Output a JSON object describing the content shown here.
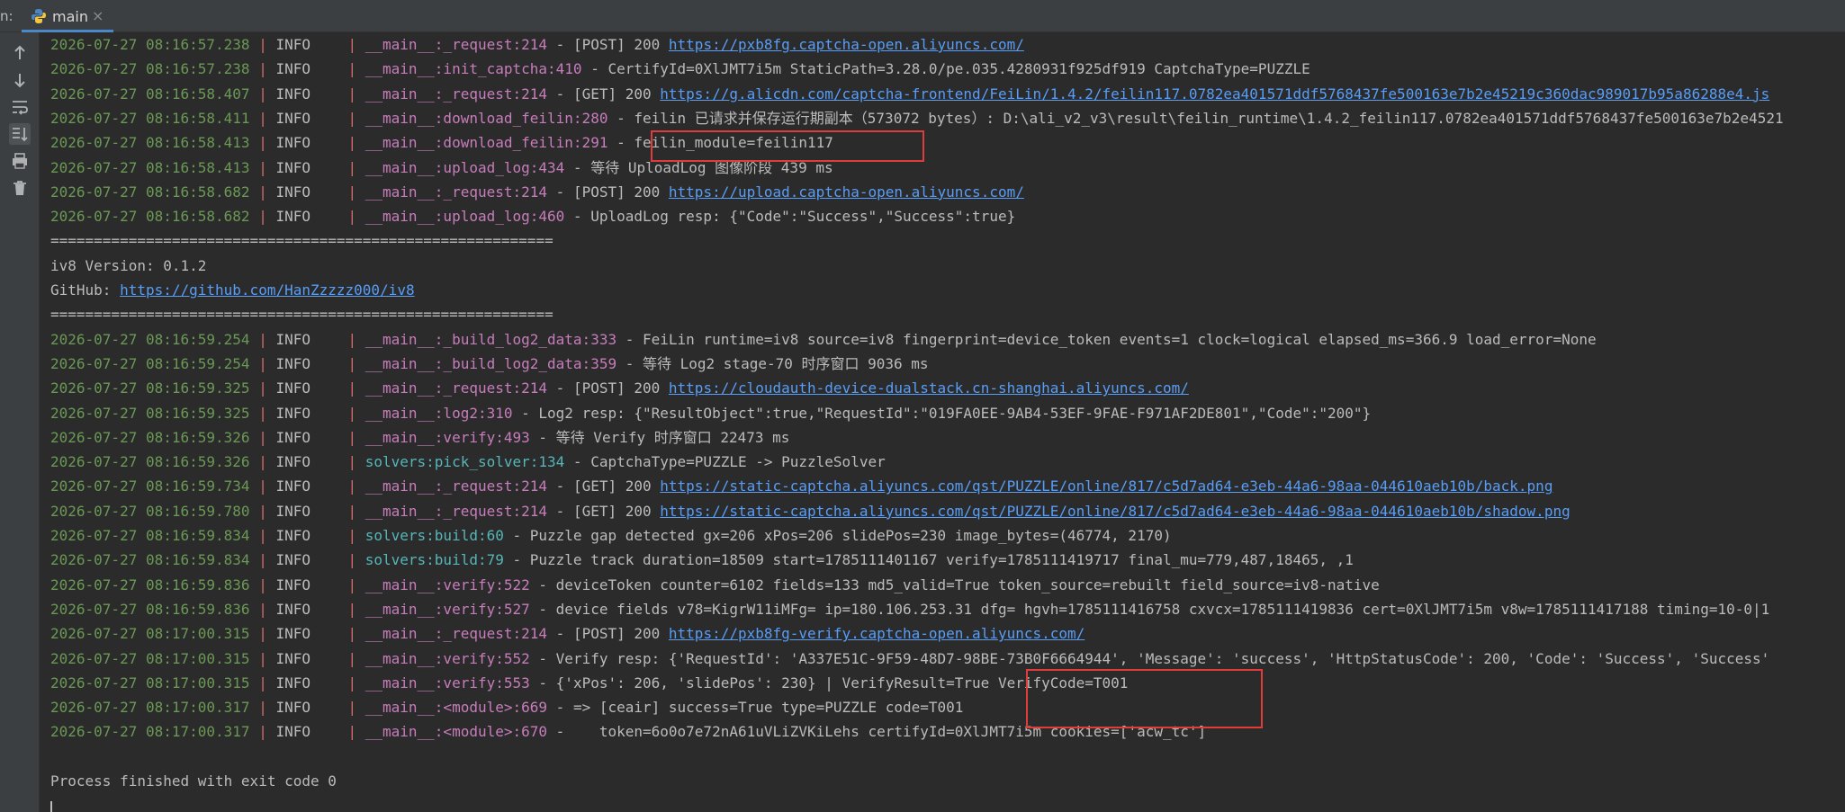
{
  "tabbar": {
    "run_label": "n:",
    "tab_label": "main",
    "tab_close": "×"
  },
  "toolbar": {
    "buttons": [
      {
        "name": "scroll-up-icon"
      },
      {
        "name": "scroll-down-icon"
      },
      {
        "name": "soft-wrap-icon"
      },
      {
        "name": "scroll-to-end-icon"
      },
      {
        "name": "print-icon"
      },
      {
        "name": "clear-icon"
      }
    ]
  },
  "colors": {
    "timestamp": "#6a9955",
    "separator": "#d16b6b",
    "module_function": "#c77dbb",
    "solver_module": "#56b6b9",
    "link": "#589df6",
    "highlight_box": "#e03c3c"
  },
  "console": {
    "lines": [
      {
        "ts": "2026-07-27 08:16:57.238",
        "lvl": "INFO",
        "mod": "__main__:_request:214",
        "mod_class": "modfn",
        "pre": "[POST] 200 ",
        "link": "https://pxb8fg.captcha-open.aliyuncs.com/",
        "post": ""
      },
      {
        "ts": "2026-07-27 08:16:57.238",
        "lvl": "INFO",
        "mod": "__main__:init_captcha:410",
        "mod_class": "modfn",
        "pre": "CertifyId=0XlJMT7i5m StaticPath=3.28.0/pe.035.4280931f925df919 CaptchaType=PUZZLE",
        "link": "",
        "post": ""
      },
      {
        "ts": "2026-07-27 08:16:58.407",
        "lvl": "INFO",
        "mod": "__main__:_request:214",
        "mod_class": "modfn",
        "pre": "[GET] 200 ",
        "link": "https://g.alicdn.com/captcha-frontend/FeiLin/1.4.2/feilin117.0782ea401571ddf5768437fe500163e7b2e45219c360dac989017b95a86288e4.js",
        "post": ""
      },
      {
        "ts": "2026-07-27 08:16:58.411",
        "lvl": "INFO",
        "mod": "__main__:download_feilin:280",
        "mod_class": "modfn",
        "pre": "feilin 已请求并保存运行期副本（573072 bytes）: D:\\ali_v2_v3\\result\\feilin_runtime\\1.4.2_feilin117.0782ea401571ddf5768437fe500163e7b2e4521",
        "link": "",
        "post": ""
      },
      {
        "ts": "2026-07-27 08:16:58.413",
        "lvl": "INFO",
        "mod": "__main__:download_feilin:291",
        "mod_class": "modfn",
        "pre": "feilin_module=feilin117",
        "link": "",
        "post": ""
      },
      {
        "ts": "2026-07-27 08:16:58.413",
        "lvl": "INFO",
        "mod": "__main__:upload_log:434",
        "mod_class": "modfn",
        "pre": "等待 UploadLog 图像阶段 439 ms",
        "link": "",
        "post": ""
      },
      {
        "ts": "2026-07-27 08:16:58.682",
        "lvl": "INFO",
        "mod": "__main__:_request:214",
        "mod_class": "modfn",
        "pre": "[POST] 200 ",
        "link": "https://upload.captcha-open.aliyuncs.com/",
        "post": ""
      },
      {
        "ts": "2026-07-27 08:16:58.682",
        "lvl": "INFO",
        "mod": "__main__:upload_log:460",
        "mod_class": "modfn",
        "pre": "UploadLog resp: {\"Code\":\"Success\",\"Success\":true}",
        "link": "",
        "post": ""
      },
      {
        "raw": "=========================================================="
      },
      {
        "raw": "iv8 Version: 0.1.2"
      },
      {
        "raw": "GitHub: ",
        "link": "https://github.com/HanZzzzz000/iv8"
      },
      {
        "raw": "=========================================================="
      },
      {
        "ts": "2026-07-27 08:16:59.254",
        "lvl": "INFO",
        "mod": "__main__:_build_log2_data:333",
        "mod_class": "modfn",
        "pre": "FeiLin runtime=iv8 source=iv8 fingerprint=device_token events=1 clock=logical elapsed_ms=366.9 load_error=None",
        "link": "",
        "post": ""
      },
      {
        "ts": "2026-07-27 08:16:59.254",
        "lvl": "INFO",
        "mod": "__main__:_build_log2_data:359",
        "mod_class": "modfn",
        "pre": "等待 Log2 stage-70 时序窗口 9036 ms",
        "link": "",
        "post": ""
      },
      {
        "ts": "2026-07-27 08:16:59.325",
        "lvl": "INFO",
        "mod": "__main__:_request:214",
        "mod_class": "modfn",
        "pre": "[POST] 200 ",
        "link": "https://cloudauth-device-dualstack.cn-shanghai.aliyuncs.com/",
        "post": ""
      },
      {
        "ts": "2026-07-27 08:16:59.325",
        "lvl": "INFO",
        "mod": "__main__:log2:310",
        "mod_class": "modfn",
        "pre": "Log2 resp: {\"ResultObject\":true,\"RequestId\":\"019FA0EE-9AB4-53EF-9FAE-F971AF2DE801\",\"Code\":\"200\"}",
        "link": "",
        "post": ""
      },
      {
        "ts": "2026-07-27 08:16:59.326",
        "lvl": "INFO",
        "mod": "__main__:verify:493",
        "mod_class": "modfn",
        "pre": "等待 Verify 时序窗口 22473 ms",
        "link": "",
        "post": ""
      },
      {
        "ts": "2026-07-27 08:16:59.326",
        "lvl": "INFO",
        "mod": "solvers:pick_solver:134",
        "mod_class": "pkg",
        "pre": "CaptchaType=PUZZLE -> PuzzleSolver",
        "link": "",
        "post": ""
      },
      {
        "ts": "2026-07-27 08:16:59.734",
        "lvl": "INFO",
        "mod": "__main__:_request:214",
        "mod_class": "modfn",
        "pre": "[GET] 200 ",
        "link": "https://static-captcha.aliyuncs.com/qst/PUZZLE/online/817/c5d7ad64-e3eb-44a6-98aa-044610aeb10b/back.png",
        "post": ""
      },
      {
        "ts": "2026-07-27 08:16:59.780",
        "lvl": "INFO",
        "mod": "__main__:_request:214",
        "mod_class": "modfn",
        "pre": "[GET] 200 ",
        "link": "https://static-captcha.aliyuncs.com/qst/PUZZLE/online/817/c5d7ad64-e3eb-44a6-98aa-044610aeb10b/shadow.png",
        "post": ""
      },
      {
        "ts": "2026-07-27 08:16:59.834",
        "lvl": "INFO",
        "mod": "solvers:build:60",
        "mod_class": "pkg",
        "pre": "Puzzle gap detected gx=206 xPos=206 slidePos=230 image_bytes=(46774, 2170)",
        "link": "",
        "post": ""
      },
      {
        "ts": "2026-07-27 08:16:59.834",
        "lvl": "INFO",
        "mod": "solvers:build:79",
        "mod_class": "pkg",
        "pre": "Puzzle track duration=18509 start=1785111401167 verify=1785111419717 final_mu=779,487,18465, ,1",
        "link": "",
        "post": ""
      },
      {
        "ts": "2026-07-27 08:16:59.836",
        "lvl": "INFO",
        "mod": "__main__:verify:522",
        "mod_class": "modfn",
        "pre": "deviceToken counter=6102 fields=133 md5_valid=True token_source=rebuilt field_source=iv8-native",
        "link": "",
        "post": ""
      },
      {
        "ts": "2026-07-27 08:16:59.836",
        "lvl": "INFO",
        "mod": "__main__:verify:527",
        "mod_class": "modfn",
        "pre": "device fields v78=KigrW11iMFg= ip=180.106.253.31 dfg= hgvh=1785111416758 cxvcx=1785111419836 cert=0XlJMT7i5m v8w=1785111417188 timing=10-0|1",
        "link": "",
        "post": ""
      },
      {
        "ts": "2026-07-27 08:17:00.315",
        "lvl": "INFO",
        "mod": "__main__:_request:214",
        "mod_class": "modfn",
        "pre": "[POST] 200 ",
        "link": "https://pxb8fg-verify.captcha-open.aliyuncs.com/",
        "post": ""
      },
      {
        "ts": "2026-07-27 08:17:00.315",
        "lvl": "INFO",
        "mod": "__main__:verify:552",
        "mod_class": "modfn",
        "pre": "Verify resp: {'RequestId': 'A337E51C-9F59-48D7-98BE-73B0F6664944', 'Message': 'success', 'HttpStatusCode': 200, 'Code': 'Success', 'Success'",
        "link": "",
        "post": ""
      },
      {
        "ts": "2026-07-27 08:17:00.315",
        "lvl": "INFO",
        "mod": "__main__:verify:553",
        "mod_class": "modfn",
        "pre": "{'xPos': 206, 'slidePos': 230} | VerifyResult=True VerifyCode=T001",
        "link": "",
        "post": ""
      },
      {
        "ts": "2026-07-27 08:17:00.317",
        "lvl": "INFO",
        "mod": "__main__:<module>:669",
        "mod_class": "modfn",
        "pre": "=> [ceair] success=True type=PUZZLE code=T001",
        "link": "",
        "post": ""
      },
      {
        "ts": "2026-07-27 08:17:00.317",
        "lvl": "INFO",
        "mod": "__main__:<module>:670",
        "mod_class": "modfn",
        "pre": "   token=6o0o7e72nA61uVLiZVKiLehs certifyId=0XlJMT7i5m cookies=['acw_tc']",
        "link": "",
        "post": ""
      },
      {
        "raw": ""
      },
      {
        "raw": "Process finished with exit code 0"
      }
    ]
  }
}
